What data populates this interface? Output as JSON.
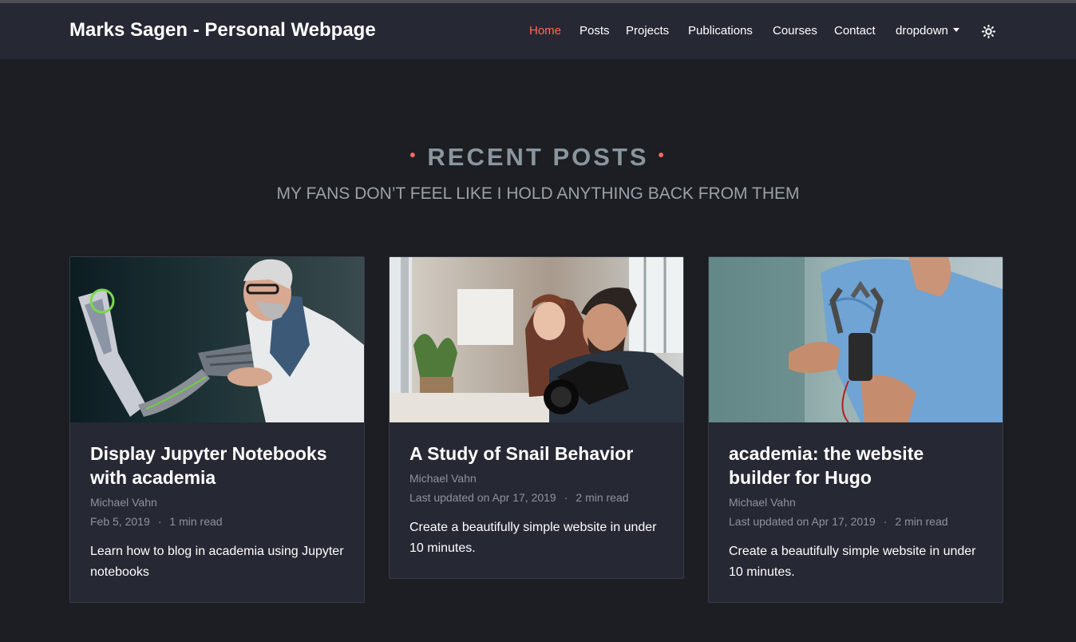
{
  "navbar": {
    "brand": "Marks Sagen - Personal Webpage",
    "links": [
      {
        "label": "Home",
        "active": true
      },
      {
        "label": "Posts"
      },
      {
        "label": "Projects"
      },
      {
        "label": "Publications"
      },
      {
        "label": "Courses"
      },
      {
        "label": "Contact"
      },
      {
        "label": "dropdown"
      }
    ],
    "theme_icon": "sun-icon"
  },
  "section": {
    "title": "RECENT POSTS",
    "subtitle": "MY FANS DON’T FEEL LIKE I HOLD ANYTHING BACK FROM THEM"
  },
  "posts": [
    {
      "title": "Display Jupyter Notebooks with academia",
      "author": "Michael Vahn",
      "date": "Feb 5, 2019",
      "read_time": "1 min read",
      "summary": "Learn how to blog in academia using Jupyter notebooks",
      "image": "scientist-robotic-hand-photo"
    },
    {
      "title": "A Study of Snail Behavior",
      "author": "Michael Vahn",
      "date": "Last updated on Apr 17, 2019",
      "read_time": "2 min read",
      "summary": "Create a beautifully simple website in under 10 minutes.",
      "image": "people-with-camera-photo"
    },
    {
      "title": "academia: the website builder for Hugo",
      "author": "Michael Vahn",
      "date": "Last updated on Apr 17, 2019",
      "read_time": "2 min read",
      "summary": "Create a beautifully simple website in under 10 minutes.",
      "image": "man-holding-robot-claw-photo"
    }
  ],
  "colors": {
    "accent": "#ff6b5b",
    "background": "#1c1e23",
    "navbar": "#262834",
    "card": "#262834"
  }
}
